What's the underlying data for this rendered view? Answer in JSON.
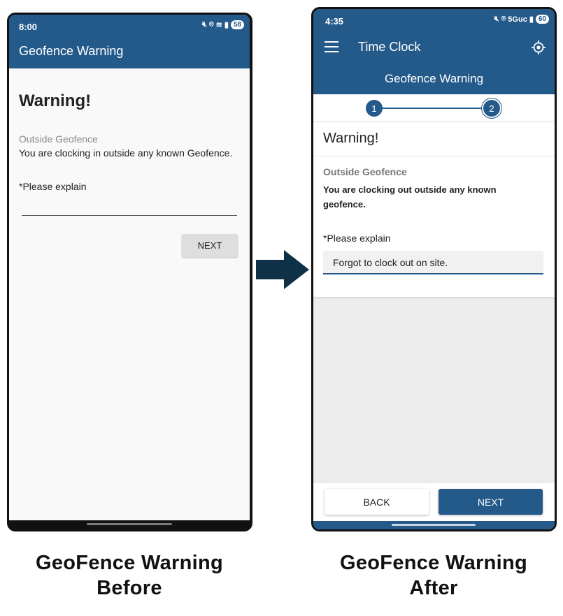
{
  "before": {
    "status_time": "8:00",
    "battery": "58",
    "appbar_title": "Geofence Warning",
    "warning_title": "Warning!",
    "outside_label": "Outside Geofence",
    "message": "You are clocking in outside any known Geofence.",
    "explain_label": "*Please explain",
    "explain_value": "",
    "next_label": "NEXT"
  },
  "after": {
    "status_time": "4:35",
    "network": "5Guc",
    "battery": "60",
    "appbar_title": "Time Clock",
    "sub_title": "Geofence Warning",
    "steps": [
      "1",
      "2"
    ],
    "warning_title": "Warning!",
    "outside_label": "Outside Geofence",
    "message": "You are clocking out outside any known geofence.",
    "explain_label": "*Please explain",
    "explain_value": "Forgot to clock out on site.",
    "back_label": "BACK",
    "next_label": "NEXT"
  },
  "captions": {
    "before_line1": "GeoFence Warning",
    "before_line2": "Before",
    "after_line1": "GeoFence Warning",
    "after_line2": "After"
  },
  "colors": {
    "brand": "#245a8a",
    "arrow": "#0e3147"
  }
}
